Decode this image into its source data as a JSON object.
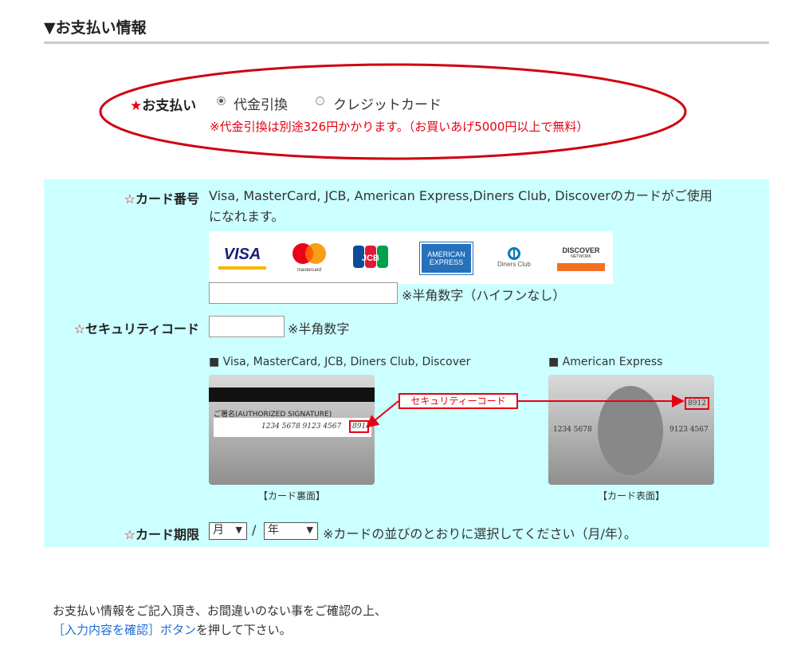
{
  "section": {
    "title": "▼お支払い情報"
  },
  "payment": {
    "star": "★",
    "label": "お支払い",
    "options": [
      {
        "label": "代金引換",
        "selected": true
      },
      {
        "label": "クレジットカード",
        "selected": false
      }
    ],
    "note": "※代金引換は別途326円かかります。（お買いあげ5000円以上で無料）"
  },
  "card_number": {
    "star": "☆",
    "label": "カード番号",
    "description_line1": "Visa, MasterCard, JCB, American Express,Diners Club, Discoverのカードがご使用",
    "description_line2": "になれます。",
    "logos": {
      "visa": "VISA",
      "mastercard": "mastercard",
      "jcb": "JCB",
      "amex_line1": "AMERICAN",
      "amex_line2": "EXPRESS",
      "diners": "Diners Club",
      "discover": "DISCOVER",
      "discover_sub": "NETWORK"
    },
    "input_value": "",
    "hint": "※半角数字（ハイフンなし）"
  },
  "security": {
    "star": "☆",
    "label": "セキュリティコード",
    "input_value": "",
    "hint": "※半角数字",
    "left_caption": "■ Visa, MasterCard, JCB, Diners Club, Discover",
    "right_caption": "■ American Express",
    "callout": "セキュリティーコード",
    "back_card": {
      "signature_label": "ご署名(AUTHORIZED SIGNATURE)",
      "number": "1234 5678 9123 4567",
      "code": "891",
      "caption": "【カード裏面】"
    },
    "front_card": {
      "code": "8912",
      "number_left": "1234 5678",
      "number_right": "9123 4567",
      "caption": "【カード表面】"
    }
  },
  "expiry": {
    "star": "☆",
    "label": "カード期限",
    "month": "月",
    "separator": "/",
    "year": "年",
    "hint": "※カードの並びのとおりに選択してください（月/年）。"
  },
  "footer": {
    "line1": "お支払い情報をご記入頂き、お間違いのない事をご確認の上、",
    "link": "［入力内容を確認］ボタン",
    "line2_rest": "を押して下さい。"
  },
  "colors": {
    "red": "#e60012",
    "cyan_bg": "#ccffff",
    "link": "#1a6fd6"
  }
}
